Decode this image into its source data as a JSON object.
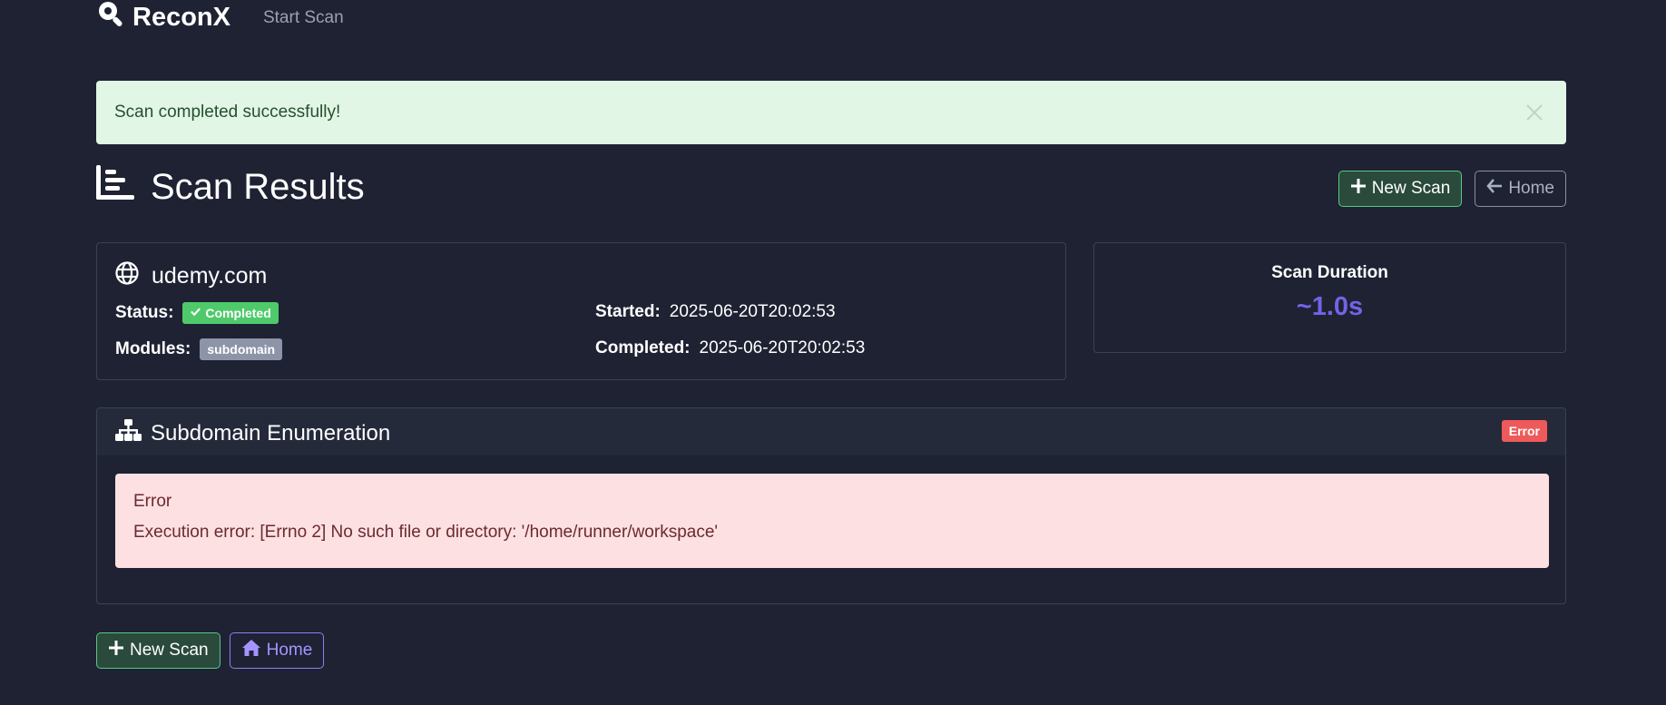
{
  "nav": {
    "brand": "ReconX",
    "links": [
      "Start Scan"
    ]
  },
  "alert": {
    "message": "Scan completed successfully!"
  },
  "header": {
    "title": "Scan Results",
    "new_scan_label": "New Scan",
    "home_label": "Home"
  },
  "scan": {
    "domain": "udemy.com",
    "status_label": "Status:",
    "status_value": "Completed",
    "modules_label": "Modules:",
    "modules": [
      "subdomain"
    ],
    "started_label": "Started:",
    "started_value": "2025-06-20T20:02:53",
    "completed_label": "Completed:",
    "completed_value": "2025-06-20T20:02:53"
  },
  "duration": {
    "label": "Scan Duration",
    "value": "~1.0s"
  },
  "subdomain": {
    "title": "Subdomain Enumeration",
    "badge": "Error",
    "error_title": "Error",
    "error_message": "Execution error: [Errno 2] No such file or directory: '/home/runner/workspace'"
  },
  "footer": {
    "new_scan_label": "New Scan",
    "home_label": "Home"
  },
  "colors": {
    "background": "#1e2233",
    "success": "#4fca6b",
    "danger": "#ee5a5a",
    "accent": "#7264e8"
  }
}
